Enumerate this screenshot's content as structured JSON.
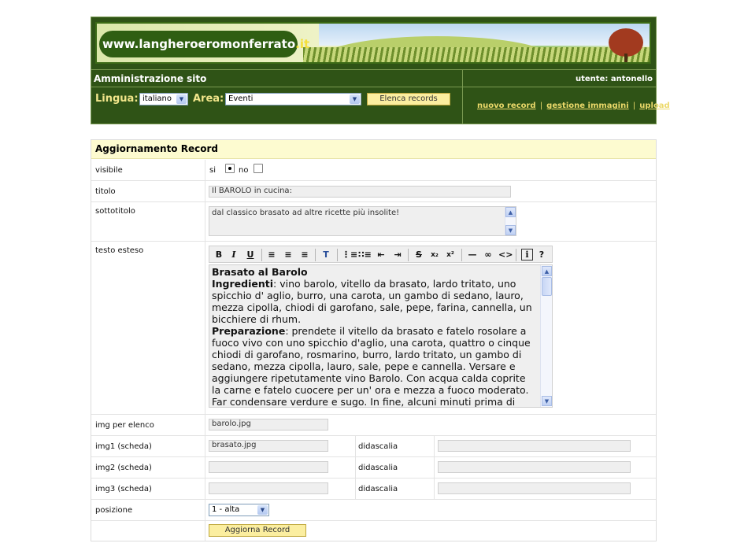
{
  "header": {
    "logo": {
      "prefix": "www.",
      "name": "langheroeromonferrato",
      "tld": ".it"
    },
    "admin_title": "Amministrazione sito",
    "user": "utente: antonello",
    "lingua_label": "Lingua:",
    "lingua_value": "italiano",
    "area_label": "Area:",
    "area_value": "Eventi",
    "list_button": "Elenca records",
    "links": [
      "nuovo record",
      "gestione immagini",
      "upload"
    ],
    "separator": "|",
    "colors": {
      "panel": "#2f5316",
      "accent_text": "#f1e58a",
      "link": "#ecd96a"
    }
  },
  "form": {
    "title": "Aggiornamento Record",
    "visibile": {
      "label": "visibile",
      "yes": "si",
      "no": "no",
      "selected": "si"
    },
    "titolo": {
      "label": "titolo",
      "value": "Il BAROLO in cucina:"
    },
    "sottotitolo": {
      "label": "sottotitolo",
      "value": "dal classico brasato ad altre ricette più insolite!"
    },
    "testo": {
      "label": "testo esteso",
      "toolbar": [
        "bold-icon",
        "italic-icon",
        "underline-icon",
        "align-left-icon",
        "align-center-icon",
        "align-right-icon",
        "paste-format-icon",
        "ordered-list-icon",
        "unordered-list-icon",
        "outdent-icon",
        "indent-icon",
        "strikethrough-icon",
        "subscript-icon",
        "superscript-icon",
        "horizontal-rule-icon",
        "link-icon",
        "source-code-icon",
        "info-icon",
        "help-icon"
      ],
      "heading": "Brasato al Barolo",
      "ingredienti_label": "Ingredienti",
      "ingredienti_text": ": vino barolo, vitello da brasato, lardo tritato, uno spicchio d' aglio, burro, una carota, un gambo di sedano, lauro, mezza cipolla, chiodi di garofano, sale, pepe, farina, cannella, un bicchiere di rhum.",
      "preparazione_label": "Preparazione",
      "preparazione_text": ": prendete il vitello da brasato e fatelo rosolare a fuoco vivo con uno spicchio d'aglio, una carota, quattro o cinque chiodi di garofano, rosmarino, burro, lardo tritato, un gambo di sedano, mezza cipolla, lauro, sale, pepe e cannella. Versare e aggiungere ripetutamente vino Barolo. Con acqua calda coprite la carne e fatelo cuocere per un' ora e mezza a fuoco moderato. Far condensare verdure e sugo. In fine, alcuni minuti prima di portare"
    },
    "img_elenco": {
      "label": "img per elenco",
      "value": "barolo.jpg"
    },
    "img1": {
      "label": "img1 (scheda)",
      "value": "brasato.jpg",
      "caption_label": "didascalia",
      "caption": ""
    },
    "img2": {
      "label": "img2 (scheda)",
      "value": "",
      "caption_label": "didascalia",
      "caption": ""
    },
    "img3": {
      "label": "img3 (scheda)",
      "value": "",
      "caption_label": "didascalia",
      "caption": ""
    },
    "posizione": {
      "label": "posizione",
      "value": "1 - alta"
    },
    "submit": "Aggiorna Record"
  }
}
